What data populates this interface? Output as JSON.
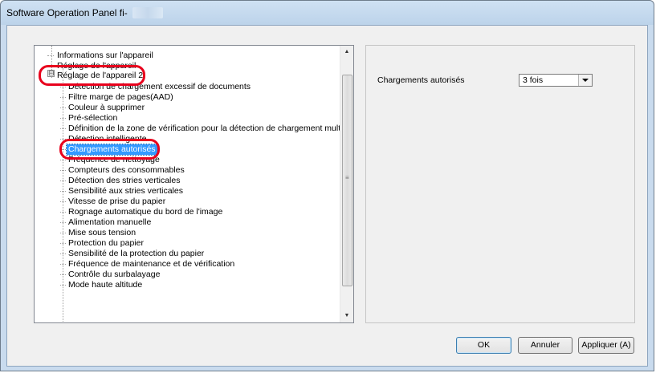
{
  "window": {
    "title": "Software Operation Panel fi-"
  },
  "tree": {
    "items": [
      {
        "label": "Informations sur l'appareil"
      },
      {
        "label": "Réglage de l'appareil"
      },
      {
        "label": "Réglage de l'appareil 2",
        "expanded": true
      },
      {
        "label": "Détection de chargement excessif de documents"
      },
      {
        "label": "Filtre marge de pages(AAD)"
      },
      {
        "label": "Couleur à supprimer"
      },
      {
        "label": "Pré-sélection"
      },
      {
        "label": "Définition de la zone de vérification pour la détection de chargement multiple"
      },
      {
        "label": "Détection intelligente"
      },
      {
        "label": "Chargements autorisés",
        "selected": true
      },
      {
        "label": "Fréquence de nettoyage"
      },
      {
        "label": "Compteurs des consommables"
      },
      {
        "label": "Détection des stries verticales"
      },
      {
        "label": "Sensibilité aux stries verticales"
      },
      {
        "label": "Vitesse de prise du papier"
      },
      {
        "label": "Rognage automatique du bord de l'image"
      },
      {
        "label": "Alimentation manuelle"
      },
      {
        "label": "Mise sous tension"
      },
      {
        "label": "Protection du papier"
      },
      {
        "label": "Sensibilité de la protection du papier"
      },
      {
        "label": "Fréquence de maintenance et de vérification"
      },
      {
        "label": "Contrôle du surbalayage"
      },
      {
        "label": "Mode haute altitude"
      }
    ],
    "expander_symbol": "⊟"
  },
  "panel": {
    "setting_label": "Chargements autorisés",
    "combo_value": "3 fois"
  },
  "buttons": {
    "ok": "OK",
    "cancel": "Annuler",
    "apply": "Appliquer (A)"
  },
  "colors": {
    "highlight": "#e8001c",
    "selection": "#3399ff"
  }
}
